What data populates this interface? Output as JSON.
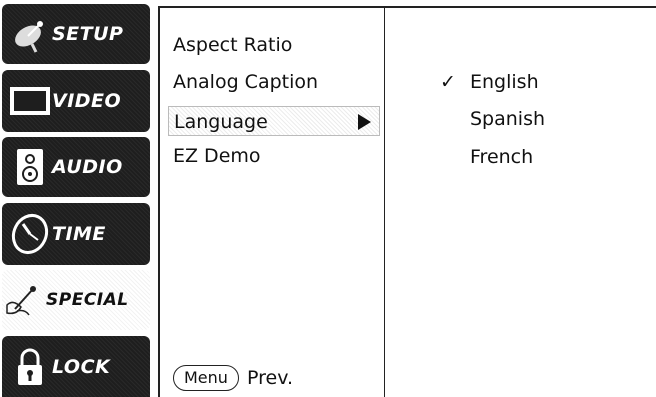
{
  "tabs": [
    {
      "label": "SETUP",
      "icon": "satellite-dish-icon"
    },
    {
      "label": "VIDEO",
      "icon": "tv-screen-icon"
    },
    {
      "label": "AUDIO",
      "icon": "speaker-icon"
    },
    {
      "label": "TIME",
      "icon": "clock-icon"
    },
    {
      "label": "SPECIAL",
      "icon": "magic-wand-icon",
      "selected": true
    },
    {
      "label": "LOCK",
      "icon": "padlock-icon"
    }
  ],
  "menu": {
    "items": [
      "Aspect Ratio",
      "Analog Caption",
      "Language",
      "EZ Demo"
    ],
    "selected": "Language"
  },
  "submenu": {
    "options": [
      "English",
      "Spanish",
      "French"
    ],
    "checked": "English",
    "check_mark": "✓"
  },
  "footer": {
    "menu_button": "Menu",
    "prev_label": "Prev."
  }
}
